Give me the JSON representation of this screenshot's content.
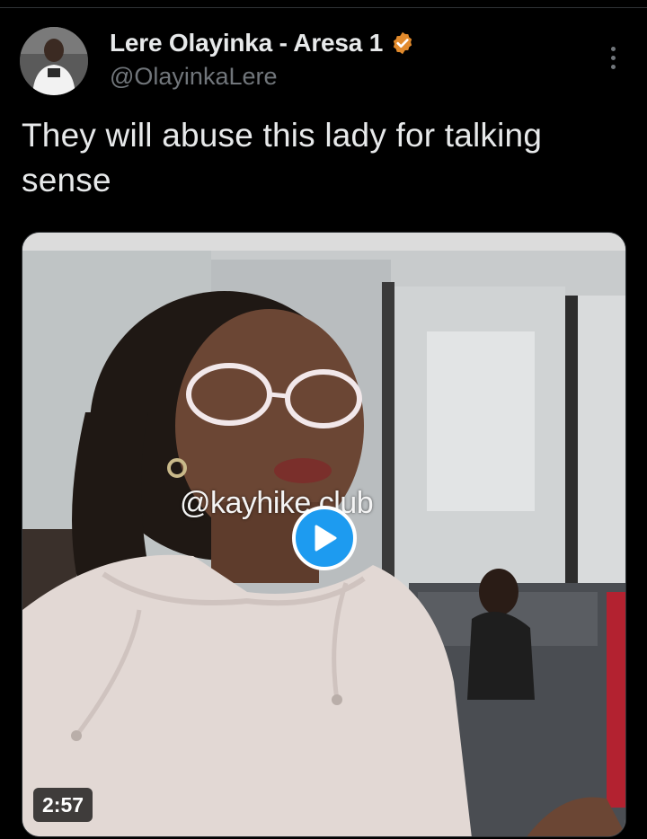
{
  "author": {
    "display_name": "Lere Olayinka - Aresa 1",
    "handle": "@OlayinkaLere",
    "verified": true,
    "avatar_icon": "user-avatar"
  },
  "tweet": {
    "text": "They will abuse this lady for talking sense"
  },
  "media": {
    "type": "video",
    "watermark": "@kayhikers_club",
    "watermark_visible": "@kayhike   club",
    "duration": "2:57",
    "play_icon": "play-icon"
  },
  "menu": {
    "icon": "more-vertical-icon"
  },
  "colors": {
    "background": "#000000",
    "text_primary": "#e7e9ea",
    "text_secondary": "#71767b",
    "accent": "#1d9bf0",
    "verified_badge": "#e18a2c"
  }
}
